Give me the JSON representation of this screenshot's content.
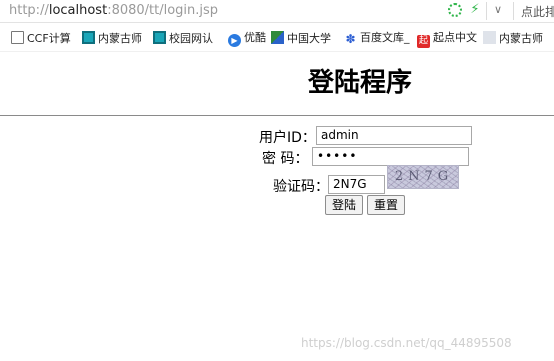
{
  "browser": {
    "url_prefix": "http://",
    "url_host": "localhost",
    "url_rest": ":8080/tt/login.jsp",
    "right_label": "点此排",
    "icons": [
      "loading-spinner-icon",
      "lightning-icon",
      "chevron-down-icon"
    ]
  },
  "bookmarks": [
    {
      "label": "CCF计算",
      "icon": "document-icon"
    },
    {
      "label": "内蒙古师",
      "icon": "teal-site-icon"
    },
    {
      "label": "校园网认",
      "icon": "teal-site-icon"
    },
    {
      "label": "优酷",
      "icon": "youku-icon"
    },
    {
      "label": "中国大学",
      "icon": "flag-icon"
    },
    {
      "label": "百度文库_",
      "icon": "baidu-paw-icon"
    },
    {
      "label": "起点中文",
      "icon": "qidian-icon"
    },
    {
      "label": "内蒙古师",
      "icon": "gray-site-icon"
    }
  ],
  "page": {
    "title": "登陆程序",
    "form": {
      "userid_label": "用户ID：",
      "userid_value": "admin",
      "password_label": "密  码：",
      "password_value": "•••••",
      "captcha_label": "验证码：",
      "captcha_value": "2N7G",
      "captcha_image_text": "2N7G",
      "login_button": "登陆",
      "reset_button": "重置"
    }
  },
  "watermark": "https://blog.csdn.net/qq_44895508"
}
